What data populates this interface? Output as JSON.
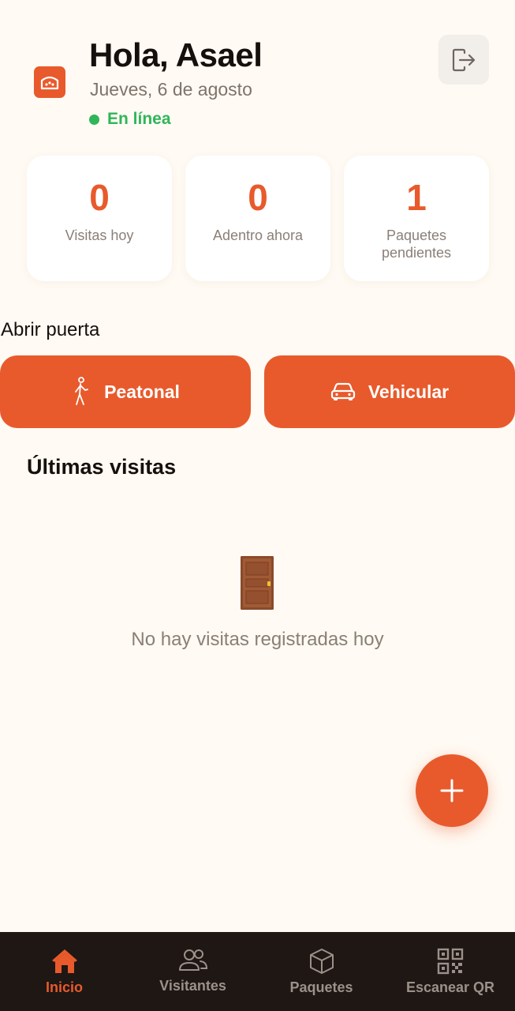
{
  "header": {
    "greeting": "Hola, Asael",
    "date": "Jueves, 6 de agosto",
    "status": "En línea",
    "logo_icon": "building-icon",
    "logout_icon": "logout-icon"
  },
  "stats": [
    {
      "value": "0",
      "label": "Visitas hoy"
    },
    {
      "value": "0",
      "label": "Adentro ahora"
    },
    {
      "value": "1",
      "label": "Paquetes pendientes"
    }
  ],
  "door": {
    "title": "Abrir puerta",
    "pedestrian_label": "Peatonal",
    "vehicle_label": "Vehicular"
  },
  "recent": {
    "title": "Últimas visitas",
    "empty_text": "No hay visitas registradas hoy",
    "empty_icon": "door-icon"
  },
  "fab": {
    "icon": "plus-icon"
  },
  "nav": [
    {
      "label": "Inicio",
      "icon": "home-icon",
      "active": true
    },
    {
      "label": "Visitantes",
      "icon": "users-icon",
      "active": false
    },
    {
      "label": "Paquetes",
      "icon": "package-icon",
      "active": false
    },
    {
      "label": "Escanear QR",
      "icon": "qr-icon",
      "active": false
    }
  ],
  "colors": {
    "accent": "#e85a2c",
    "background": "#fffaf3",
    "online": "#2fb65a",
    "nav_background": "#1e1714"
  }
}
